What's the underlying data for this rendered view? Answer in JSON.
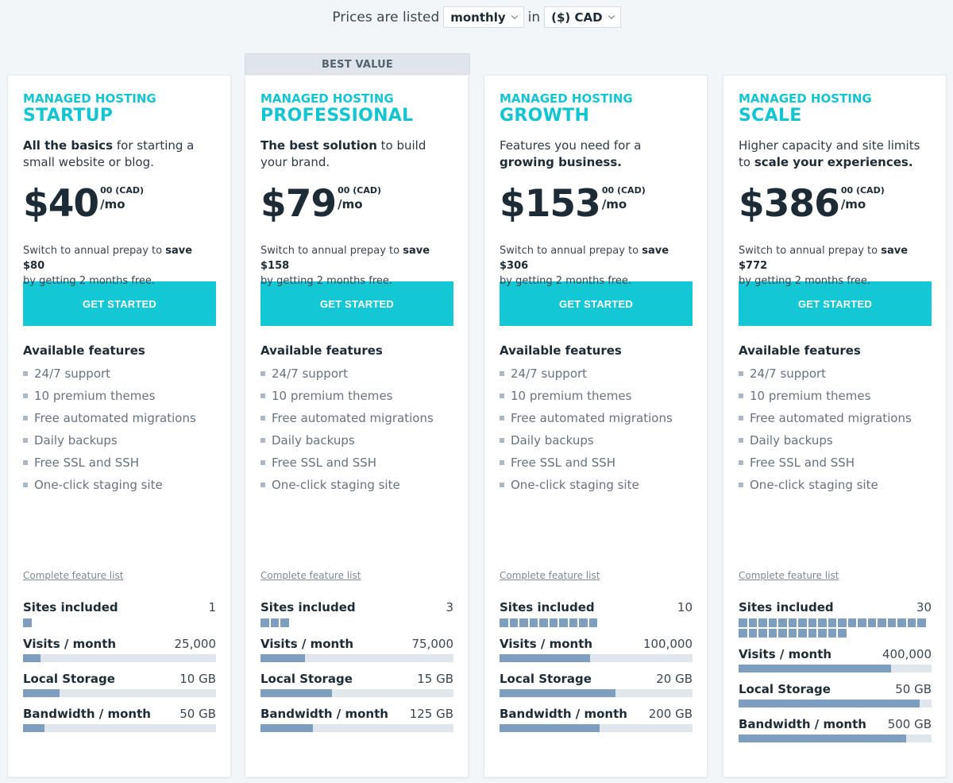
{
  "header": {
    "prefix": "Prices are listed",
    "period": "monthly",
    "joiner": "in",
    "currency": "($) CAD"
  },
  "badge": "BEST VALUE",
  "common": {
    "eyebrow": "MANAGED HOSTING",
    "cents": "00 (CAD)",
    "per": "/mo",
    "cta": "GET STARTED",
    "features_title": "Available features",
    "features": [
      "24/7 support",
      "10 premium themes",
      "Free automated migrations",
      "Daily backups",
      "Free SSL and SSH",
      "One-click staging site"
    ],
    "feature_link": "Complete feature list",
    "annual_pre": "Switch to annual prepay to",
    "annual_post": "by getting 2 months free.",
    "labels": {
      "sites": "Sites included",
      "visits": "Visits / month",
      "storage": "Local Storage",
      "bandwidth": "Bandwidth / month"
    }
  },
  "colors": {
    "accent": "#14c7d4",
    "bar": "#7d9ebe",
    "track": "#dfe6ec"
  },
  "plans": [
    {
      "name": "STARTUP",
      "desc_parts": [
        {
          "t": "All the basics",
          "b": true
        },
        {
          "t": " for starting a small website or blog.",
          "b": false
        }
      ],
      "price": "$40",
      "save": "save $80",
      "sites": "1",
      "sites_count": 1,
      "visits": "25,000",
      "visits_fill": 0.09,
      "storage": "10 GB",
      "storage_fill": 0.19,
      "bandwidth": "50 GB",
      "bandwidth_fill": 0.11
    },
    {
      "name": "PROFESSIONAL",
      "desc_parts": [
        {
          "t": "The best solution",
          "b": true
        },
        {
          "t": " to build your brand.",
          "b": false
        }
      ],
      "price": "$79",
      "save": "save $158",
      "sites": "3",
      "sites_count": 3,
      "visits": "75,000",
      "visits_fill": 0.23,
      "storage": "15 GB",
      "storage_fill": 0.37,
      "bandwidth": "125 GB",
      "bandwidth_fill": 0.27
    },
    {
      "name": "GROWTH",
      "desc_parts": [
        {
          "t": "Features you need for a ",
          "b": false
        },
        {
          "t": "growing business.",
          "b": true
        }
      ],
      "price": "$153",
      "save": "save $306",
      "sites": "10",
      "sites_count": 10,
      "visits": "100,000",
      "visits_fill": 0.47,
      "storage": "20 GB",
      "storage_fill": 0.6,
      "bandwidth": "200 GB",
      "bandwidth_fill": 0.52
    },
    {
      "name": "SCALE",
      "desc_parts": [
        {
          "t": "Higher capacity and site limits to ",
          "b": false
        },
        {
          "t": "scale your experiences.",
          "b": true
        }
      ],
      "price": "$386",
      "save": "save $772",
      "sites": "30",
      "sites_count": 30,
      "visits": "400,000",
      "visits_fill": 0.79,
      "storage": "50 GB",
      "storage_fill": 0.94,
      "bandwidth": "500 GB",
      "bandwidth_fill": 0.87
    }
  ]
}
